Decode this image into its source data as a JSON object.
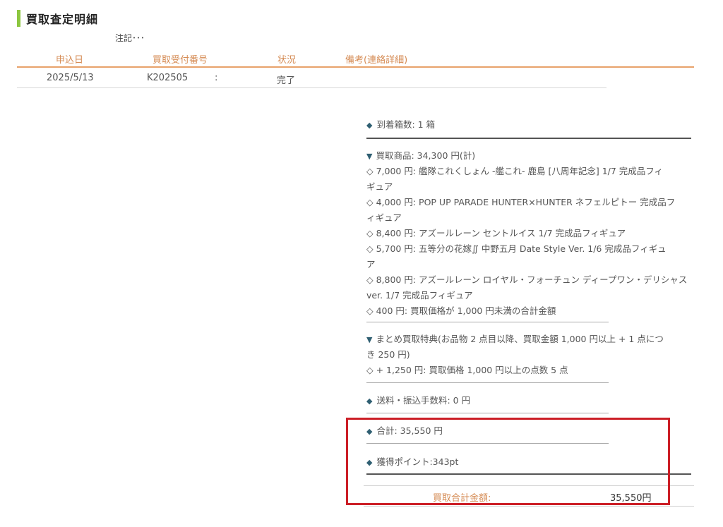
{
  "title": "買取査定明細",
  "note": "注記･･･",
  "table": {
    "headers": [
      "申込日",
      "買取受付番号",
      "状況",
      "備考(連絡詳細)"
    ],
    "row": {
      "date": "2025/5/13",
      "number": "K202505",
      "number_suffix": ":",
      "status": "完了",
      "remarks": ""
    }
  },
  "details": {
    "boxes": "到着箱数: 1 箱",
    "purchase_header": "買取商品: 34,300 円(計)",
    "items": [
      "◇ 7,000 円: 艦隊これくしょん -艦これ- 鹿島 [八周年記念] 1/7 完成品フィ",
      "ギュア",
      "◇ 4,000 円: POP UP PARADE HUNTER×HUNTER ネフェルピトー 完成品フ",
      "ィギュア",
      "◇ 8,400 円: アズールレーン セントルイス 1/7 完成品フィギュア",
      "◇ 5,700 円: 五等分の花嫁∬ 中野五月 Date Style Ver. 1/6 完成品フィギュ",
      "ア",
      "◇ 8,800 円: アズールレーン ロイヤル・フォーチュン ディープワン・デリシャス",
      "ver. 1/7 完成品フィギュア",
      "◇ 400 円: 買取価格が 1,000 円未満の合計金額"
    ],
    "bonus_header_1": "まとめ買取特典(お品物 2 点目以降、買取金額 1,000 円以上 + 1 点につ",
    "bonus_header_2": "き 250 円)",
    "bonus_item": "◇ + 1,250 円: 買取価格 1,000 円以上の点数 5 点",
    "fees": "送料・振込手数料: 0 円",
    "total": "合計: 35,550 円",
    "points": "獲得ポイント:343pt"
  },
  "summary": {
    "label": "買取合計金額:",
    "value": "35,550円"
  },
  "colors": {
    "accent_green": "#8cc63f",
    "header_orange": "#d58b54",
    "highlight_red": "#cc1f27"
  }
}
